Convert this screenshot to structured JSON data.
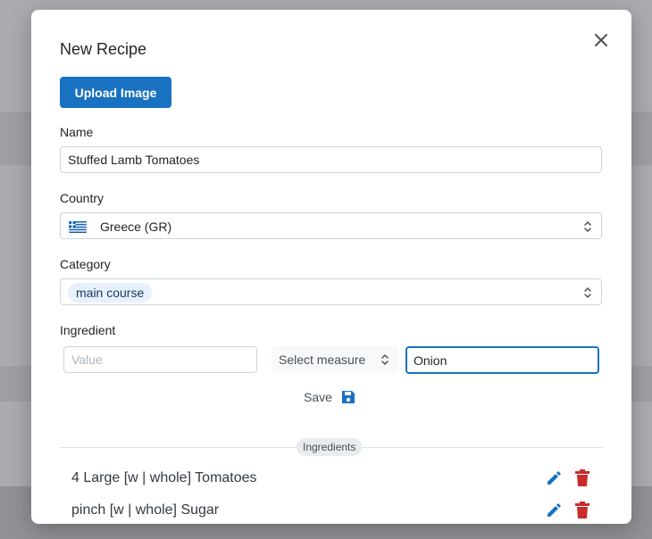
{
  "modal": {
    "title": "New Recipe",
    "upload_label": "Upload Image"
  },
  "form": {
    "name_label": "Name",
    "name_value": "Stuffed Lamb Tomatoes",
    "country_label": "Country",
    "country_value": "Greece (GR)",
    "category_label": "Category",
    "category_value": "main course",
    "ingredient_label": "Ingredient",
    "value_placeholder": "Value",
    "measure_placeholder": "Select measure",
    "ingredient_name_value": "Onion",
    "save_label": "Save"
  },
  "ingredients": {
    "heading": "Ingredients",
    "items": [
      {
        "text": "4 Large  [w | whole] Tomatoes"
      },
      {
        "text": "pinch  [w | whole] Sugar"
      }
    ]
  },
  "colors": {
    "primary": "#1971c2",
    "danger": "#c92a2a",
    "chip_bg": "#e7f0fb"
  },
  "icons": [
    "close-icon",
    "greece-flag-icon",
    "chevron-updown-icon",
    "save-icon",
    "edit-icon",
    "trash-icon"
  ]
}
